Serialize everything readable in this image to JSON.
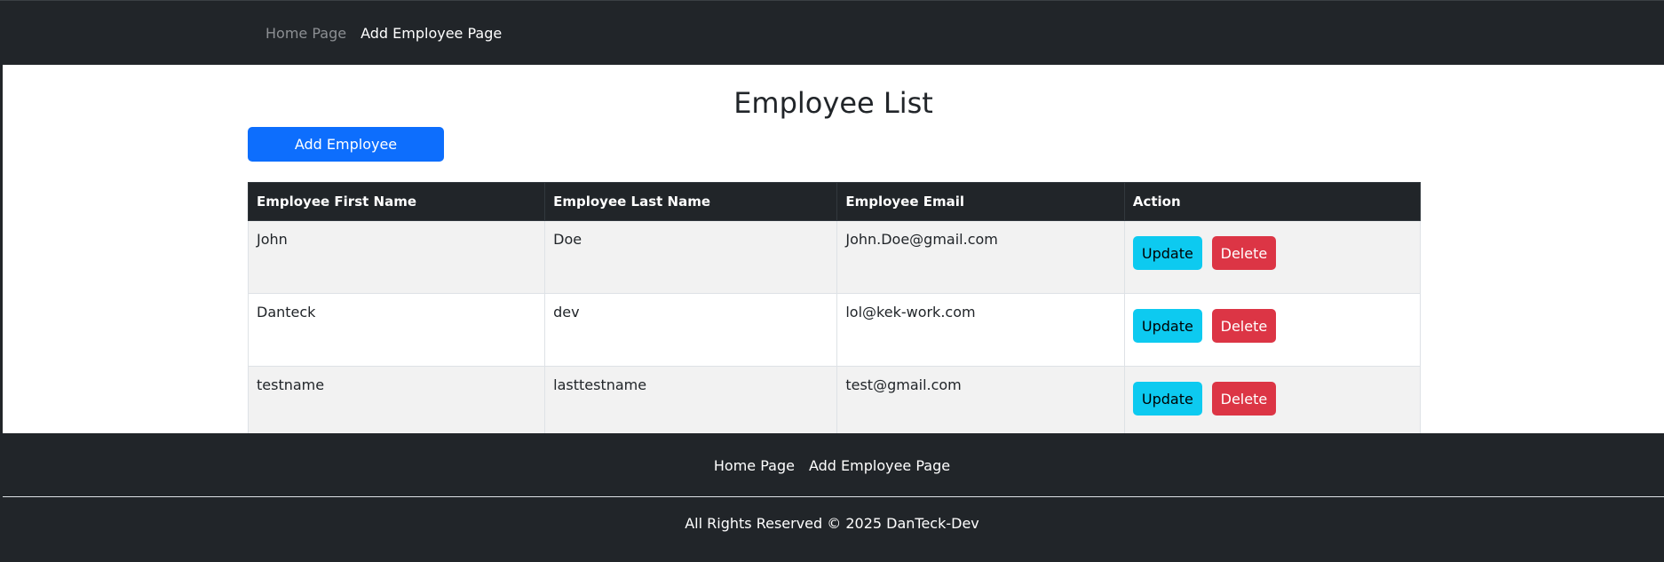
{
  "navbar": {
    "links": [
      {
        "label": "Home Page",
        "state": "muted"
      },
      {
        "label": "Add Employee Page",
        "state": "active"
      }
    ]
  },
  "main": {
    "title": "Employee List",
    "add_button_label": "Add Employee",
    "table": {
      "headers": [
        "Employee First Name",
        "Employee Last Name",
        "Employee Email",
        "Action"
      ],
      "rows": [
        {
          "first": "John",
          "last": "Doe",
          "email": "John.Doe@gmail.com"
        },
        {
          "first": "Danteck",
          "last": "dev",
          "email": "lol@kek-work.com"
        },
        {
          "first": "testname",
          "last": "lasttestname",
          "email": "test@gmail.com"
        }
      ],
      "update_label": "Update",
      "delete_label": "Delete"
    }
  },
  "footer": {
    "links": [
      "Home Page",
      "Add Employee Page"
    ],
    "copyright": "All Rights Reserved © 2025 DanTeck-Dev"
  },
  "colors": {
    "dark": "#212529",
    "primary": "#0d6efd",
    "info": "#0dcaf0",
    "danger": "#dc3545"
  }
}
